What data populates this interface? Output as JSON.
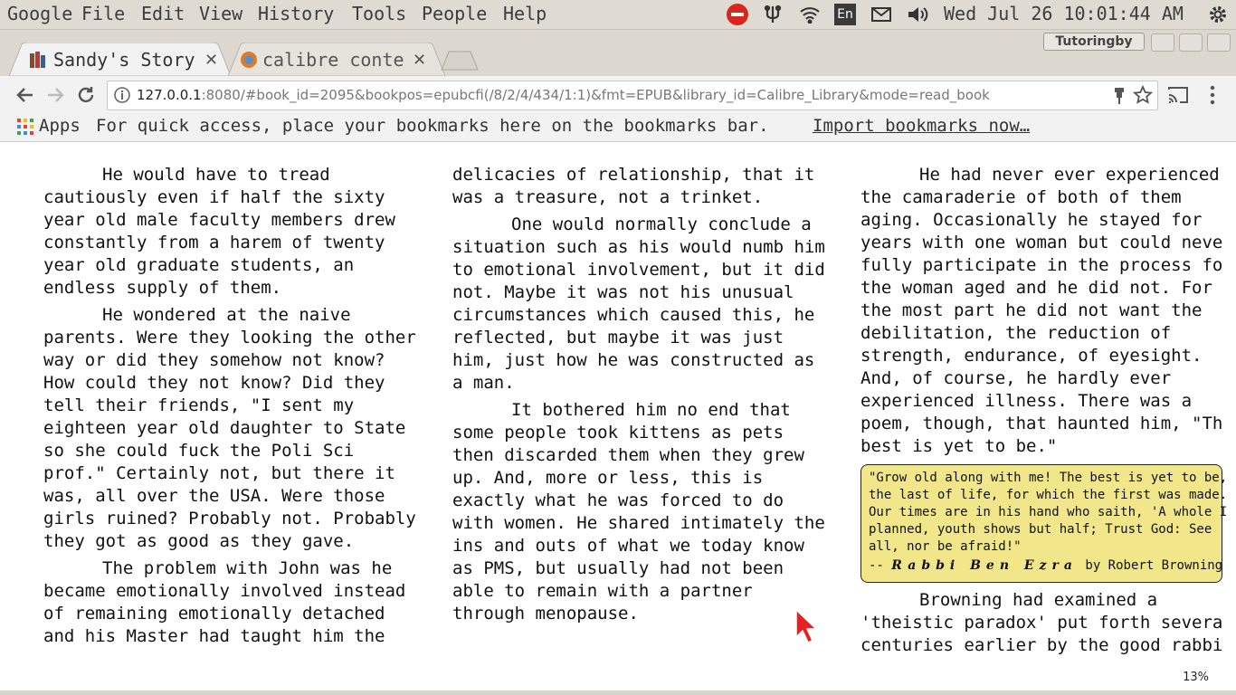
{
  "menubar": {
    "app": "Google",
    "items": [
      "File",
      "Edit",
      "View",
      "History",
      "Tools",
      "People",
      "Help"
    ],
    "keyboard": "En",
    "clock": "Wed Jul 26 10:01:44 AM"
  },
  "tabs": [
    {
      "title": "Sandy's Story",
      "active": true
    },
    {
      "title": "calibre conte",
      "active": false
    }
  ],
  "profile": "Tutoringby",
  "address": {
    "host": "127.0.0.1",
    "rest": ":8080/#book_id=2095&bookpos=epubcfi(/8/2/4/434/1:1)&fmt=EPUB&library_id=Calibre_Library&mode=read_book"
  },
  "bookmarks": {
    "apps": "Apps",
    "message": "For quick access, place your bookmarks here on the bookmarks bar.",
    "import": "Import bookmarks now…"
  },
  "book": {
    "col1": [
      [
        "He would have to tread",
        "cautiously even if half the sixty",
        "year old male faculty members drew",
        "constantly from a harem of twenty",
        "year old graduate students, an",
        "endless supply of them."
      ],
      [
        "He wondered at the naive",
        "parents. Were they looking the other",
        "way or did they somehow not know?",
        "How could they not know? Did they",
        "tell their friends, \"I sent my",
        "eighteen year old daughter to State",
        "so she could fuck the Poli Sci",
        "prof.\" Certainly not, but there it",
        "was, all over the USA. Were those",
        "girls ruined? Probably not. Probably",
        "they got as good as they gave."
      ],
      [
        "The problem with John was he",
        "became emotionally involved instead",
        "of remaining emotionally detached",
        "and his Master had taught him the"
      ]
    ],
    "col2": [
      [
        "delicacies of relationship, that it",
        "was a treasure, not a trinket."
      ],
      [
        "One would normally conclude a",
        "situation such as his would numb him",
        "to emotional involvement, but it did",
        "not. Maybe it was not his unusual",
        "circumstances which caused this, he",
        "reflected, but maybe it was just",
        "him, just how he was constructed as",
        "a man."
      ],
      [
        "It bothered him no end that",
        "some people took kittens as pets",
        "then discarded them when they grew",
        "up. And, more or less, this is",
        "exactly what he was forced to do",
        "with women. He shared intimately the",
        "ins and outs of what we today know",
        "as PMS, but usually had not been",
        "able to remain with a partner",
        "through menopause."
      ]
    ],
    "col3a": [
      [
        "He had never ever experienced",
        "the camaraderie of both of them",
        "aging. Occasionally he stayed for",
        "years with one woman but could neve",
        "fully participate in the process fo",
        "the woman aged and he did not. For",
        "the most part he did not want the",
        "debilitation, the reduction of",
        "strength, endurance, of eyesight.",
        "And, of course, he hardly ever",
        "experienced illness. There was a",
        "poem, though, that haunted him, \"Th",
        "best is yet to be.\""
      ]
    ],
    "quote": [
      "\"Grow old along with me! The best is yet to be,",
      "the last of life, for which the first was made.",
      "Our times are in his hand who saith, 'A whole I",
      "planned, youth shows but half; Trust God: See",
      "all, nor be afraid!\""
    ],
    "quote_prefix": "-- ",
    "quote_rabbi": "Rabbi Ben Ezra",
    "quote_by": " by Robert Browning",
    "col3b": [
      [
        "Browning had examined a",
        "'theistic paradox' put forth severa",
        "centuries earlier by the good rabbi"
      ]
    ]
  },
  "progress": "13%"
}
